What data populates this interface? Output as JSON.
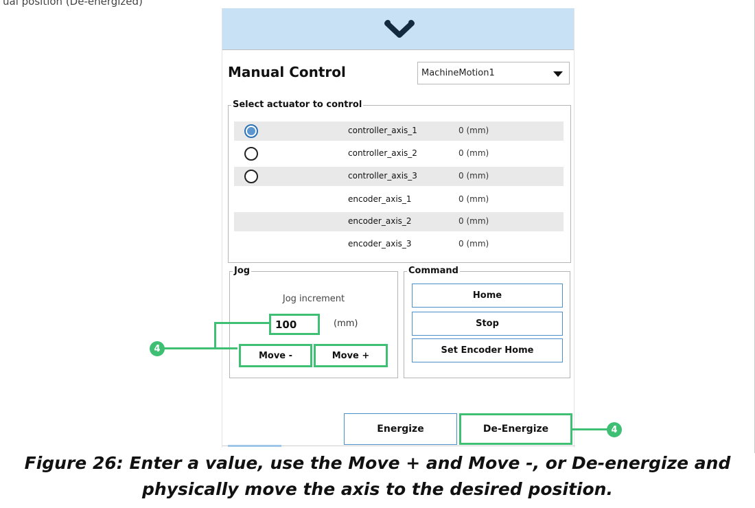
{
  "top_crop_text": "ual position (De-energized)",
  "header": {
    "logo_icon": "vention-chevron-logo"
  },
  "title": "Manual Control",
  "machine_select": {
    "value": "MachineMotion1"
  },
  "actuator_group": {
    "legend": "Select actuator to control",
    "rows": [
      {
        "name": "controller_axis_1",
        "value": "0 (mm)",
        "radio": true,
        "checked": true,
        "shaded": true
      },
      {
        "name": "controller_axis_2",
        "value": "0 (mm)",
        "radio": true,
        "checked": false,
        "shaded": false
      },
      {
        "name": "controller_axis_3",
        "value": "0 (mm)",
        "radio": true,
        "checked": false,
        "shaded": true
      },
      {
        "name": "encoder_axis_1",
        "value": "0 (mm)",
        "radio": false,
        "checked": false,
        "shaded": false
      },
      {
        "name": "encoder_axis_2",
        "value": "0 (mm)",
        "radio": false,
        "checked": false,
        "shaded": true
      },
      {
        "name": "encoder_axis_3",
        "value": "0 (mm)",
        "radio": false,
        "checked": false,
        "shaded": false
      }
    ]
  },
  "jog": {
    "legend": "Jog",
    "increment_label": "Jog increment",
    "increment_value": "100",
    "unit": "(mm)",
    "move_minus": "Move -",
    "move_plus": "Move +"
  },
  "command": {
    "legend": "Command",
    "home": "Home",
    "stop": "Stop",
    "set_encoder_home": "Set Encoder Home"
  },
  "power": {
    "energize": "Energize",
    "de_energize": "De-Energize"
  },
  "callouts": {
    "jog_badge": "4",
    "deenergize_badge": "4"
  },
  "colors": {
    "highlight": "#3fbf74",
    "header_band": "#c9e1f4",
    "button_border": "#4a8fc9",
    "radio_fill": "#5b96cf"
  },
  "caption": "Figure 26: Enter a value, use the Move + and Move -, or De-energize and physically move the axis to the desired position."
}
